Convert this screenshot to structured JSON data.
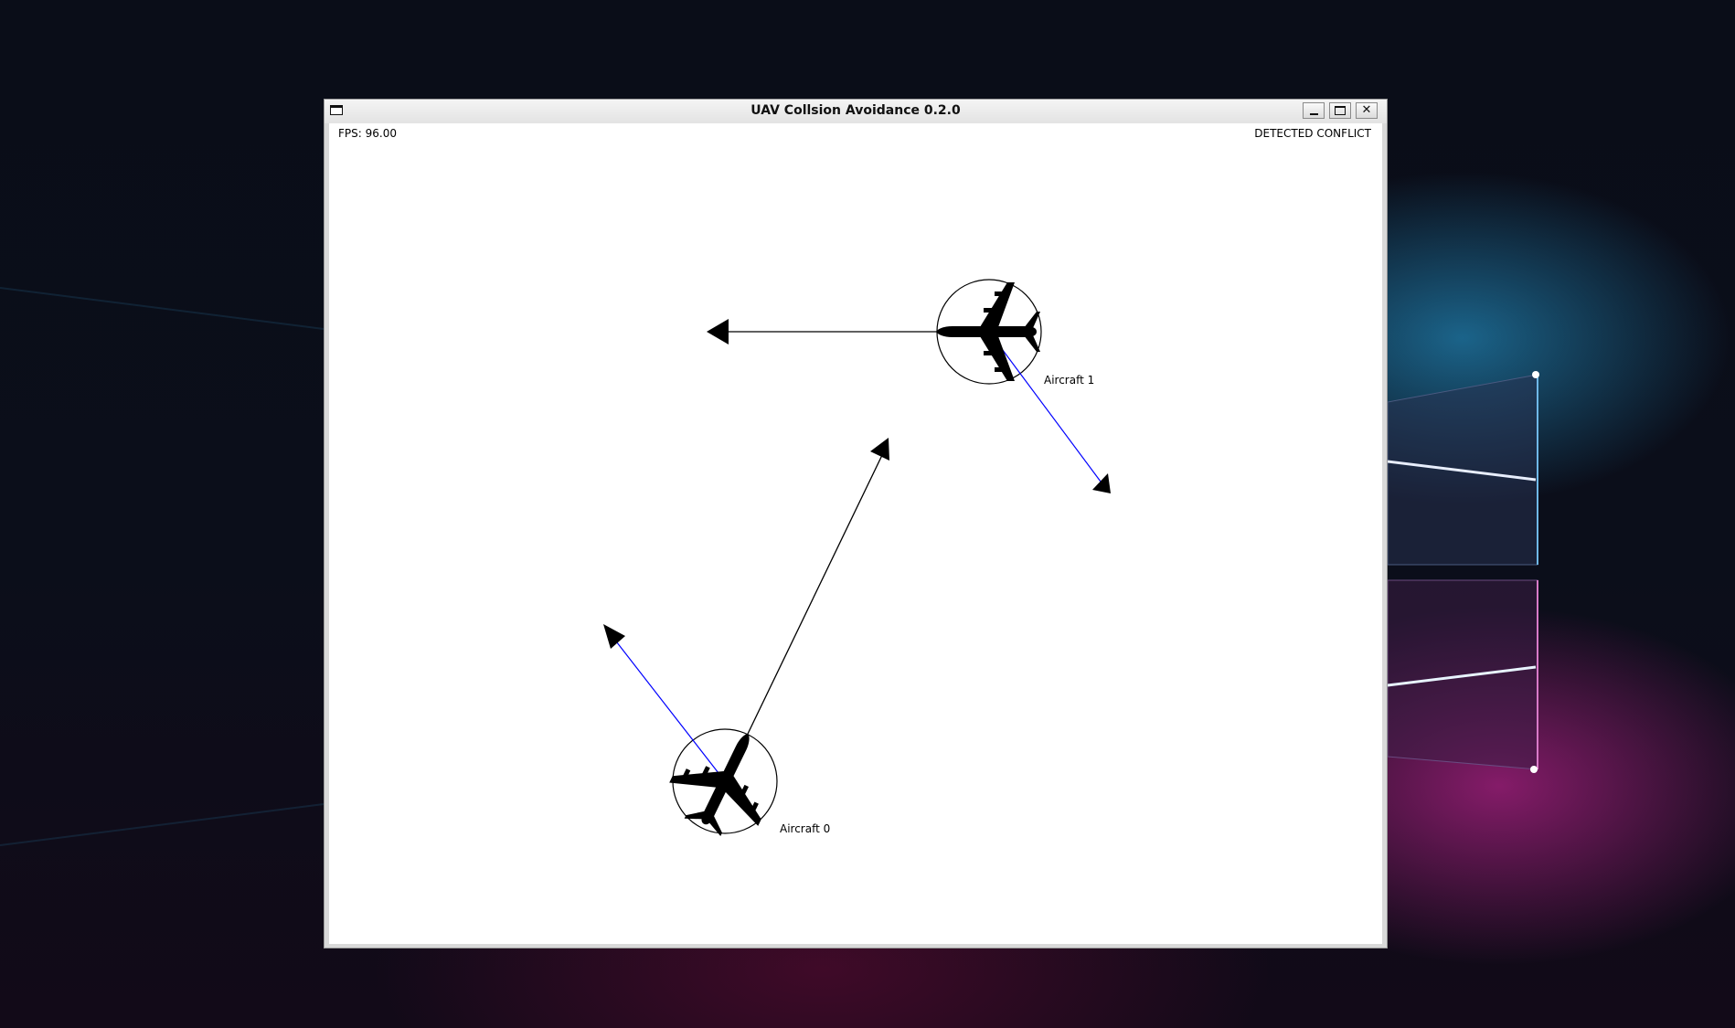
{
  "window": {
    "title": "UAV Collsion Avoidance 0.2.0"
  },
  "hud": {
    "fps": "FPS: 96.00",
    "status": "DETECTED CONFLICT"
  },
  "aircraft": [
    {
      "label": "Aircraft 0"
    },
    {
      "label": "Aircraft 1"
    }
  ],
  "colors": {
    "velocity": "#000000",
    "avoidance": "#0000ff",
    "canvas": "#ffffff"
  },
  "icons": [
    "app-window-icon",
    "minimize-icon",
    "maximize-icon",
    "close-icon",
    "airplane-icon"
  ]
}
